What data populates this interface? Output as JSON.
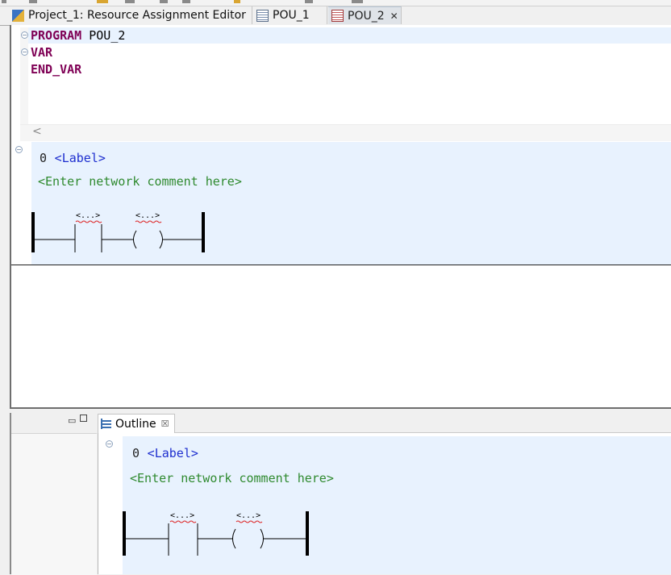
{
  "editor_tabs": [
    {
      "label": "Project_1: Resource Assignment Editor",
      "icon": "resource-editor-icon",
      "active": false
    },
    {
      "label": "POU_1",
      "icon": "pou-file-icon",
      "active": false
    },
    {
      "label": "POU_2",
      "icon": "pou-file-icon",
      "active": true,
      "close": "✕"
    }
  ],
  "declaration": {
    "lines": [
      {
        "keyword": "PROGRAM",
        "text": "POU_2"
      },
      {
        "keyword": "VAR",
        "text": ""
      },
      {
        "keyword": "END_VAR",
        "text": ""
      }
    ],
    "scroll_left": "<"
  },
  "network": {
    "number": "0",
    "label": "<Label>",
    "comment": "<Enter network comment here>",
    "contact_var": "<...>",
    "coil_var": "<...>"
  },
  "outline_panel": {
    "tab_label": "Outline",
    "tab_close": "☒",
    "network": {
      "number": "0",
      "label": "<Label>",
      "comment": "<Enter network comment here>",
      "contact_var": "<...>",
      "coil_var": "<...>"
    }
  },
  "left_panel": {
    "minimize": "▭"
  },
  "colors": {
    "keyword": "#7f0055",
    "label": "#1e2fcf",
    "comment": "#2f8a2f",
    "network_bg": "#e8f2fe"
  }
}
